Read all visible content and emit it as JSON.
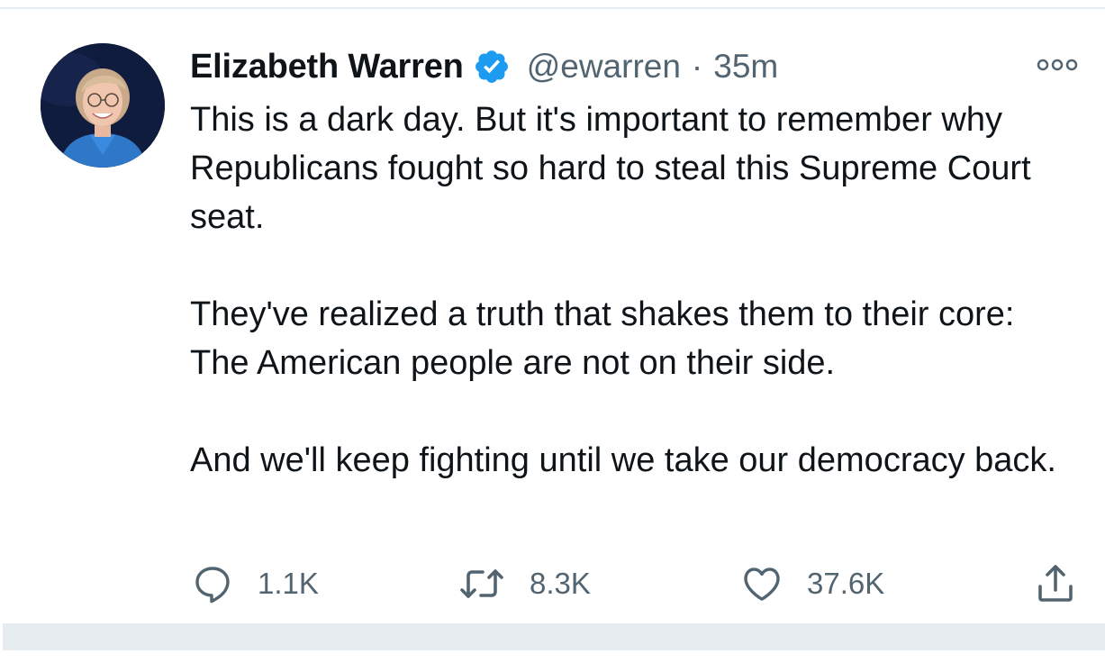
{
  "tweet": {
    "author": {
      "display_name": "Elizabeth Warren",
      "handle": "@ewarren",
      "verified": true
    },
    "separator": "·",
    "timestamp": "35m",
    "paragraphs": [
      "This is a dark day. But it's important to remember why Republicans fought so hard to steal this Supreme Court seat.",
      "They've realized a truth that shakes them to their core: The American people are not on their side.",
      "And we'll keep fighting until we take our democracy back."
    ],
    "actions": {
      "reply_count": "1.1K",
      "retweet_count": "8.3K",
      "like_count": "37.6K"
    }
  },
  "icons": {
    "verified": "verified-badge-icon",
    "more": "more-options-icon",
    "reply": "reply-icon",
    "retweet": "retweet-icon",
    "like": "heart-icon",
    "share": "share-icon"
  },
  "colors": {
    "verified_blue": "#1d9bf0",
    "text_primary": "#0f1419",
    "text_secondary": "#536471",
    "divider": "#e6ecf0"
  }
}
